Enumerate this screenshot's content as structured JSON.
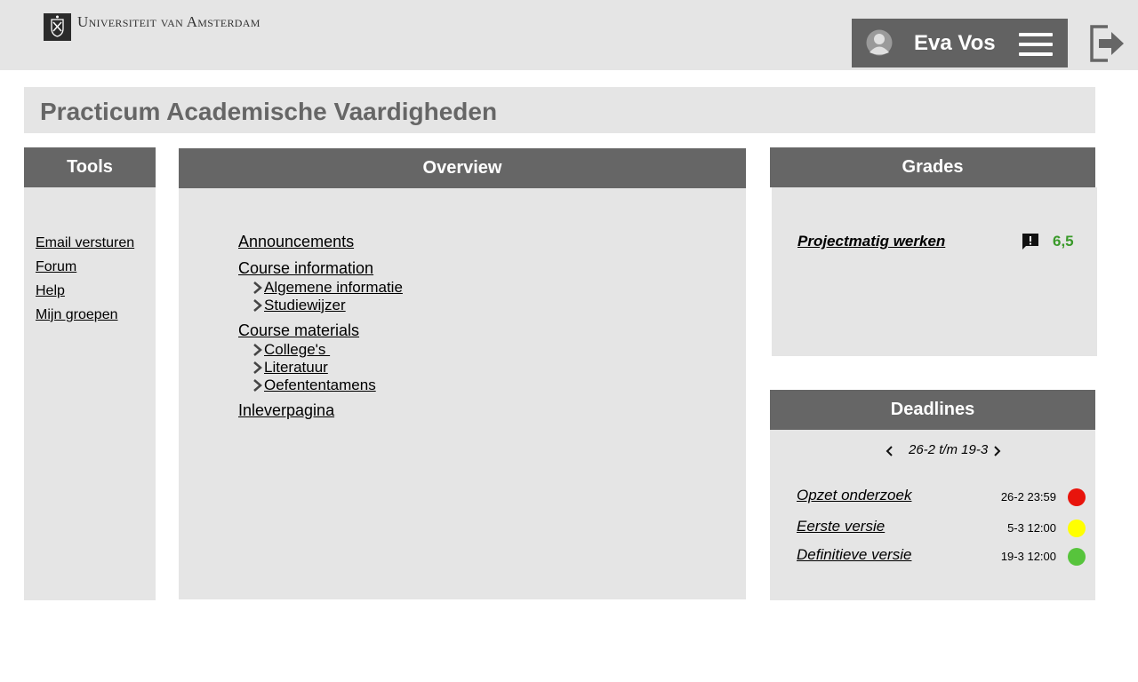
{
  "header": {
    "university": "Universiteit van Amsterdam",
    "user_name": "Eva Vos"
  },
  "page": {
    "title": "Practicum Academische Vaardigheden"
  },
  "tools": {
    "heading": "Tools",
    "items": [
      {
        "label": "Email versturen"
      },
      {
        "label": "Forum"
      },
      {
        "label": "Help"
      },
      {
        "label": "Mijn groepen"
      }
    ]
  },
  "overview": {
    "heading": "Overview",
    "sections": [
      {
        "label": "Announcements",
        "children": []
      },
      {
        "label": "Course information",
        "children": [
          "Algemene informatie",
          "Studiewijzer"
        ]
      },
      {
        "label": "Course materials",
        "children": [
          "College's ",
          "Literatuur",
          "Oefententamens"
        ]
      },
      {
        "label": "Inleverpagina",
        "children": []
      }
    ]
  },
  "grades": {
    "heading": "Grades",
    "items": [
      {
        "name": "Projectmatig werken",
        "value": "6,5",
        "value_color": "#3a9a2a"
      }
    ]
  },
  "deadlines": {
    "heading": "Deadlines",
    "range": "26-2 t/m 19-3",
    "items": [
      {
        "name": "Opzet onderzoek",
        "date": "26-2 23:59",
        "status_color": "#e8140c"
      },
      {
        "name": "Eerste versie",
        "date": "5-3 12:00",
        "status_color": "#ffff00"
      },
      {
        "name": "Definitieve versie",
        "date": "19-3 12:00",
        "status_color": "#57c43c"
      }
    ]
  },
  "colors": {
    "panel_header": "#666666",
    "panel_bg": "#e5e5e5",
    "grade_green": "#3a9a2a"
  }
}
